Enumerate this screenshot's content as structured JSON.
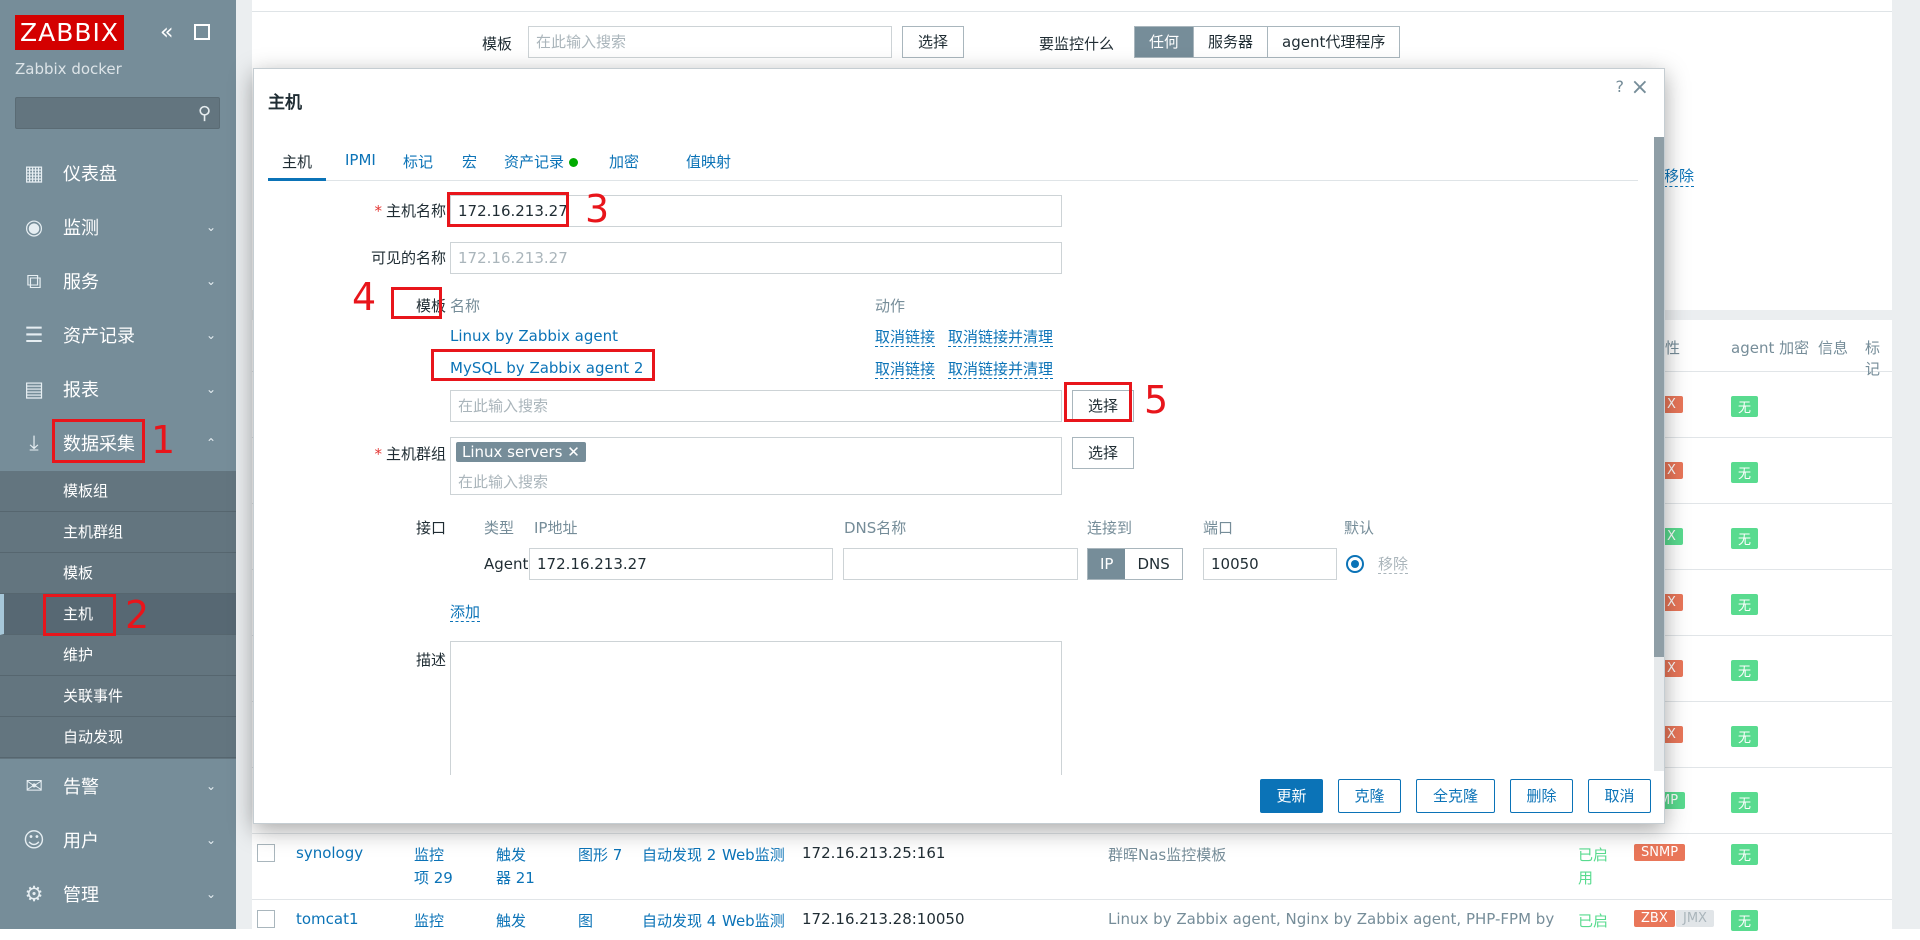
{
  "sidebar": {
    "logo": "ZABBIX",
    "server_name": "Zabbix docker",
    "nav": [
      {
        "label": "仪表盘",
        "icon": "dashboard-icon"
      },
      {
        "label": "监测",
        "icon": "eye-icon"
      },
      {
        "label": "服务",
        "icon": "services-icon"
      },
      {
        "label": "资产记录",
        "icon": "list-icon"
      },
      {
        "label": "报表",
        "icon": "report-icon"
      },
      {
        "label": "数据采集",
        "icon": "download-icon"
      },
      {
        "label": "告警",
        "icon": "mail-icon"
      },
      {
        "label": "用户",
        "icon": "users-icon"
      },
      {
        "label": "管理",
        "icon": "gear-icon"
      }
    ],
    "submenu": [
      "模板组",
      "主机群组",
      "模板",
      "主机",
      "维护",
      "关联事件",
      "自动发现"
    ]
  },
  "annotations": [
    "1",
    "2",
    "3",
    "4",
    "5"
  ],
  "background": {
    "filter": {
      "template_label": "模板",
      "template_placeholder": "在此输入搜索",
      "select": "选择",
      "monitor_label": "要监控什么",
      "monitor_options": [
        "任何",
        "服务器",
        "agent代理程序"
      ],
      "remove": "移除"
    },
    "table_headers": [
      "性",
      "agent 加密",
      "信息",
      "标记"
    ],
    "row_tag_none": "无",
    "rows": [
      {
        "name": "synology",
        "items": "监控项 29",
        "triggers": "触发器 21",
        "graphs": "图形 7",
        "discovery": "自动发现 2",
        "web": "Web监测",
        "interface": "172.16.213.25:161",
        "templates": "群晖Nas监控模板",
        "status": "已启用",
        "avail": "SNMP",
        "enc": "无"
      },
      {
        "name": "tomcat1",
        "items": "监控",
        "triggers": "触发",
        "graphs": "图",
        "discovery": "自动发现 4",
        "web": "Web监测",
        "interface": "172.16.213.28:10050",
        "templates": "Linux by Zabbix agent, Nginx by Zabbix agent, PHP-FPM by",
        "status": "已启",
        "avail": "ZBX",
        "avail2": "JMX",
        "enc": "无"
      }
    ]
  },
  "modal": {
    "title": "主机",
    "help": "?",
    "tabs": [
      "主机",
      "IPMI",
      "标记",
      "宏",
      "资产记录",
      "加密",
      "值映射"
    ],
    "host_name_label": "主机名称",
    "host_name_value": "172.16.213.27",
    "visible_name_label": "可见的名称",
    "visible_name_placeholder": "172.16.213.27",
    "templates_label": "模板",
    "templates_col_name": "名称",
    "templates_col_action": "动作",
    "templates": [
      {
        "name": "Linux by Zabbix agent",
        "unlink": "取消链接",
        "unlink_clear": "取消链接并清理"
      },
      {
        "name": "MySQL by Zabbix agent 2",
        "unlink": "取消链接",
        "unlink_clear": "取消链接并清理"
      }
    ],
    "search_placeholder": "在此输入搜索",
    "select": "选择",
    "groups_label": "主机群组",
    "group_chip": "Linux servers",
    "interfaces_label": "接口",
    "iface_cols": {
      "type": "类型",
      "ip": "IP地址",
      "dns": "DNS名称",
      "connect": "连接到",
      "port": "端口",
      "default": "默认"
    },
    "iface": {
      "type": "Agent",
      "ip": "172.16.213.27",
      "dns": "",
      "connect_ip": "IP",
      "connect_dns": "DNS",
      "port": "10050",
      "remove": "移除"
    },
    "add": "添加",
    "description_label": "描述",
    "buttons": {
      "update": "更新",
      "clone": "克隆",
      "full_clone": "全克隆",
      "delete": "删除",
      "cancel": "取消"
    }
  }
}
